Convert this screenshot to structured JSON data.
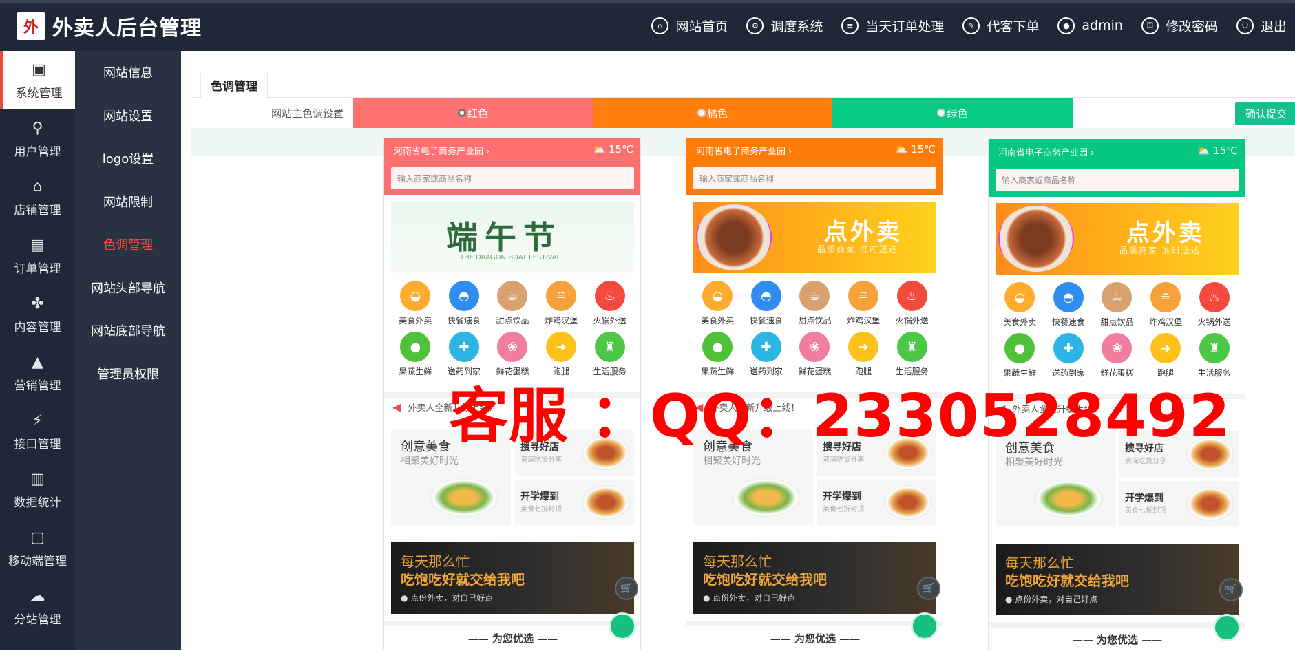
{
  "app": {
    "title": "外卖人后台管理",
    "logo_mark": "外"
  },
  "topnav": [
    {
      "label": "网站首页",
      "icon": "home-icon",
      "glyph": "⌂"
    },
    {
      "label": "调度系统",
      "icon": "dispatch-icon",
      "glyph": "⚙"
    },
    {
      "label": "当天订单处理",
      "icon": "order-list-icon",
      "glyph": "≡"
    },
    {
      "label": "代客下单",
      "icon": "proxy-order-icon",
      "glyph": "✎"
    },
    {
      "label": "admin",
      "icon": "user-icon",
      "glyph": "●"
    },
    {
      "label": "修改密码",
      "icon": "key-icon",
      "glyph": "⚿"
    },
    {
      "label": "退出",
      "icon": "power-icon",
      "glyph": "⏻"
    }
  ],
  "sidebar": [
    {
      "label": "系统管理",
      "icon": "monitor-icon",
      "glyph": "▣",
      "active": true
    },
    {
      "label": "用户管理",
      "icon": "user-gear-icon",
      "glyph": "⚲"
    },
    {
      "label": "店铺管理",
      "icon": "store-icon",
      "glyph": "⌂"
    },
    {
      "label": "订单管理",
      "icon": "document-icon",
      "glyph": "▤"
    },
    {
      "label": "内容管理",
      "icon": "grid-icon",
      "glyph": "✤"
    },
    {
      "label": "营销管理",
      "icon": "chart-up-icon",
      "glyph": "▲"
    },
    {
      "label": "接口管理",
      "icon": "plug-icon",
      "glyph": "⚡"
    },
    {
      "label": "数据统计",
      "icon": "bar-chart-icon",
      "glyph": "▥"
    },
    {
      "label": "移动端管理",
      "icon": "app-icon",
      "glyph": "▢"
    },
    {
      "label": "分站管理",
      "icon": "branch-icon",
      "glyph": "☁"
    }
  ],
  "submenu": [
    {
      "label": "网站信息"
    },
    {
      "label": "网站设置"
    },
    {
      "label": "logo设置"
    },
    {
      "label": "网站限制"
    },
    {
      "label": "色调管理",
      "active": true
    },
    {
      "label": "网站头部导航"
    },
    {
      "label": "网站底部导航"
    },
    {
      "label": "管理员权限"
    }
  ],
  "tab": {
    "label": "色调管理"
  },
  "form": {
    "label": "网站主色调设置",
    "options": [
      {
        "label": "红色",
        "color": "#fe7271",
        "selected": true
      },
      {
        "label": "橘色",
        "color": "#ff7e0e",
        "selected": false
      },
      {
        "label": "绿色",
        "color": "#05ca84",
        "selected": false
      }
    ],
    "submit": "确认提交"
  },
  "phones": [
    {
      "theme": "#fe6f6f",
      "location": "河南省电子商务产业园 ›",
      "weather": "⛅ 15℃",
      "search": "输入商家或商品名称",
      "banner": "duanwu"
    },
    {
      "theme": "#ff7c0b",
      "location": "河南省电子商务产业园 ›",
      "weather": "⛅ 15℃",
      "search": "输入商家或商品名称",
      "banner": "food"
    },
    {
      "theme": "#06c882",
      "location": "河南省电子商务产业园 ›",
      "weather": "⛅ 15℃",
      "search": "输入商家或商品名称",
      "banner": "food"
    }
  ],
  "banner_duanwu": {
    "title": "端午节",
    "subtitle": "THE DRAGON BOAT FESTIVAL"
  },
  "banner_food": {
    "title": "点外卖",
    "subtitle": "品质商家 准时送达"
  },
  "categories": [
    {
      "label": "美食外卖",
      "color": "#ffab2d",
      "glyph": "◒"
    },
    {
      "label": "快餐速食",
      "color": "#2f8cf0",
      "glyph": "◓"
    },
    {
      "label": "甜点饮品",
      "color": "#d9a16f",
      "glyph": "☕"
    },
    {
      "label": "炸鸡汉堡",
      "color": "#f5a23a",
      "glyph": "≘"
    },
    {
      "label": "火锅外送",
      "color": "#f24a3c",
      "glyph": "♨"
    },
    {
      "label": "果蔬生鲜",
      "color": "#4fc239",
      "glyph": "●"
    },
    {
      "label": "送药到家",
      "color": "#2db5e6",
      "glyph": "✚"
    },
    {
      "label": "鲜花蛋糕",
      "color": "#f17ea0",
      "glyph": "❀"
    },
    {
      "label": "跑腿",
      "color": "#ffc21d",
      "glyph": "➜"
    },
    {
      "label": "生活服务",
      "color": "#4cc746",
      "glyph": "♜"
    }
  ],
  "notice": {
    "text": "外卖人全新升级上线！",
    "icon": "speaker-icon"
  },
  "cards": {
    "big_title": "创意美食",
    "big_sub": "相聚美好时光",
    "s1_title": "搜寻好店",
    "s1_sub": "资深吃货分享",
    "s2_title": "开学爆到",
    "s2_sub": "美食七折封顶"
  },
  "promo": {
    "line1": "每天那么忙",
    "line2": "吃饱吃好就交给我吧",
    "line3": "● 点份外卖，对自己好点",
    "cart": "🛒"
  },
  "footer": {
    "text": "—— 为您优选 ——"
  },
  "watermark": "客服 ：QQ：2330528492"
}
